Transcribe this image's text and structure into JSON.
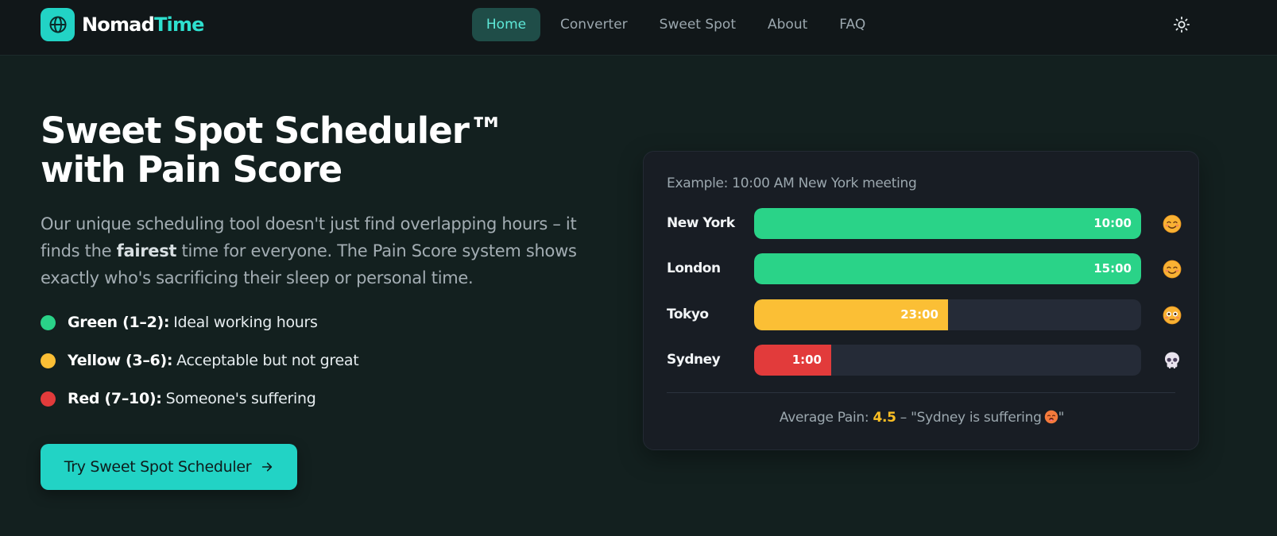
{
  "nav": {
    "brand_part1": "Nomad",
    "brand_part2": "Time",
    "links": [
      "Home",
      "Converter",
      "Sweet Spot",
      "About",
      "FAQ"
    ],
    "active": "Home"
  },
  "hero": {
    "title": "Sweet Spot Scheduler™ with Pain Score",
    "desc_before": "Our unique scheduling tool doesn't just find overlapping hours – it finds the ",
    "desc_bold": "fairest",
    "desc_after": " time for everyone. The Pain Score system shows exactly who's sacrificing their sleep or personal time.",
    "legend": [
      {
        "label": "Green (1–2):",
        "text": "Ideal working hours",
        "color": "#2ad388"
      },
      {
        "label": "Yellow (3–6):",
        "text": "Acceptable but not great",
        "color": "#fbbf35"
      },
      {
        "label": "Red (7–10):",
        "text": "Someone's suffering",
        "color": "#e23b3b"
      }
    ],
    "cta_label": "Try Sweet Spot Scheduler"
  },
  "card": {
    "caption": "Example: 10:00 AM New York meeting",
    "rows": [
      {
        "city": "New York",
        "time": "10:00",
        "fill": 1.0,
        "color": "#2ad388",
        "emoji": "smiling-face-icon"
      },
      {
        "city": "London",
        "time": "15:00",
        "fill": 1.0,
        "color": "#2ad388",
        "emoji": "smiling-face-icon"
      },
      {
        "city": "Tokyo",
        "time": "23:00",
        "fill": 0.5,
        "color": "#fbbf35",
        "emoji": "flushed-face-icon"
      },
      {
        "city": "Sydney",
        "time": "1:00",
        "fill": 0.2,
        "color": "#e23b3b",
        "emoji": "skull-icon"
      }
    ],
    "footer_prefix": "Average Pain: ",
    "footer_score": "4.5",
    "footer_suffix": " – \"Sydney is suffering",
    "footer_close": "\"",
    "footer_emoji": "hot-face-icon"
  },
  "colors": {
    "accent": "#22d3c5",
    "background": "#13201f",
    "card": "#181d24",
    "score": "#fbbf24"
  }
}
